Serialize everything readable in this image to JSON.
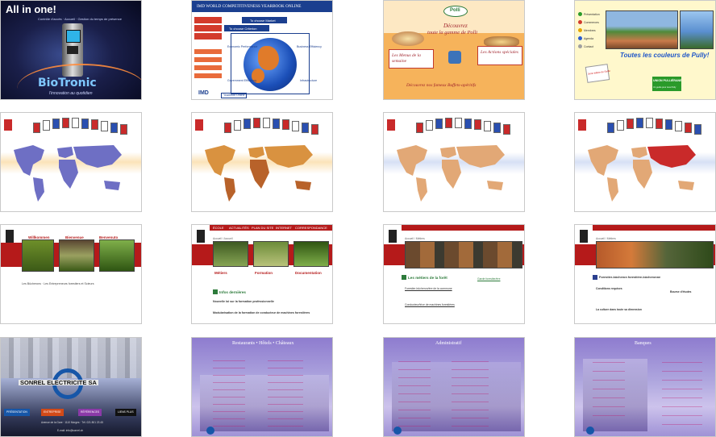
{
  "tiles": {
    "biotronic": {
      "headline": "All in one!",
      "subtitle": "Contrôle d'accès · Accueil · Gestion du temps de présence",
      "brand": "BioTronic",
      "tagline": "l'innovation au quotidien"
    },
    "imd": {
      "title": "IMD WORLD COMPETITIVENESS YEARBOOK ONLINE",
      "choose_market": "To choose Market",
      "choose_criterion": "To choose Criterion",
      "quadrants": [
        "Economic Performance",
        "Business Efficiency",
        "Government Efficiency",
        "Infrastructure"
      ],
      "logo": "IMD",
      "footer_link": "Yearbook Online",
      "menu": [
        "Country Profiles",
        "Country Rankings",
        "Criteria Rankings",
        "Statistics",
        "Methodology",
        "Contact"
      ]
    },
    "polli": {
      "brand": "Polli",
      "headline_1": "Découvrez",
      "headline_2": "toute la gamme de Polli",
      "left_box": "Les Menus de la semaine",
      "right_box": "Les Actions spéciales",
      "bottom": "Découvrez nos fameux Buffets-apéritifs"
    },
    "pully": {
      "menu": [
        "Présentation",
        "Commerces",
        "Membres",
        "Agenda",
        "Contact"
      ],
      "slogan": "Toutes les couleurs de Pully!",
      "badge": "2ème édition du Guide",
      "union": "UNION PULLIÉRANE",
      "union_sub": "Un guide pour tous Pully"
    },
    "forest_home": {
      "links": [
        "Willkommen",
        "Bienvenue",
        "Benvenuto"
      ],
      "body": "Les Bûcherons · Les Entrepreneurs forestiers et Scieurs"
    },
    "forest_formation": {
      "nav": [
        "ÉCOLE",
        "ACTUALITÉS",
        "PLAN DU SITE",
        "INTERNET",
        "CORRESPONDANCE"
      ],
      "breadcrumb": "Accueil / Accueil",
      "captions": [
        "Métiers",
        "Formation",
        "Documentation"
      ],
      "section": "Infos dernières",
      "news_1": "Nouvelle loi sur la formation professionnelle",
      "news_2": "Modularisation de la formation de conducteur de machines forestières"
    },
    "forest_metiers": {
      "breadcrumb": "Accueil / Métiers",
      "section": "Les métiers de la forêt",
      "items": [
        "Forestier-bûcheron/ère de la commune",
        "Garde forestier/ère",
        "Conducteur/trice de machines forestières"
      ]
    },
    "forest_forestier": {
      "breadcrumb": "Accueil / Métiers",
      "section": "Forestier-bûcheron forestière-bûcheronne",
      "items": [
        "Conditions requises",
        "Bourse d'études",
        "La culture dans toute sa dimension"
      ]
    },
    "sonrel": {
      "brand": "SONREL ELECTRICITE SA",
      "buttons": [
        "PRÉSENTATION",
        "ENTREPRISE",
        "RÉFÉRENCES",
        "LIENS PLUS"
      ],
      "address": "Avenue de la Gare · 1110 Morges · Tél. 021 801 23 45",
      "email": "E-mail: info@sonrel.ch"
    },
    "restaurants": {
      "title": "Restaurants • Hôtels • Châteaux"
    },
    "administratif": {
      "title": "Administratif"
    },
    "banques": {
      "title": "Banques"
    }
  },
  "colors": {
    "imd_blue": "#1b3f8f",
    "polli_orange": "#f1a243",
    "pully_green": "#2a9a2a",
    "forest_red": "#b51a1a",
    "sonrel_blue": "#1656a8",
    "purple": "#8e7ccf",
    "map_purple": "#6e6fc4",
    "map_orange": "#d99240",
    "map_tan": "#e2a876",
    "map_red": "#c92a2a"
  }
}
